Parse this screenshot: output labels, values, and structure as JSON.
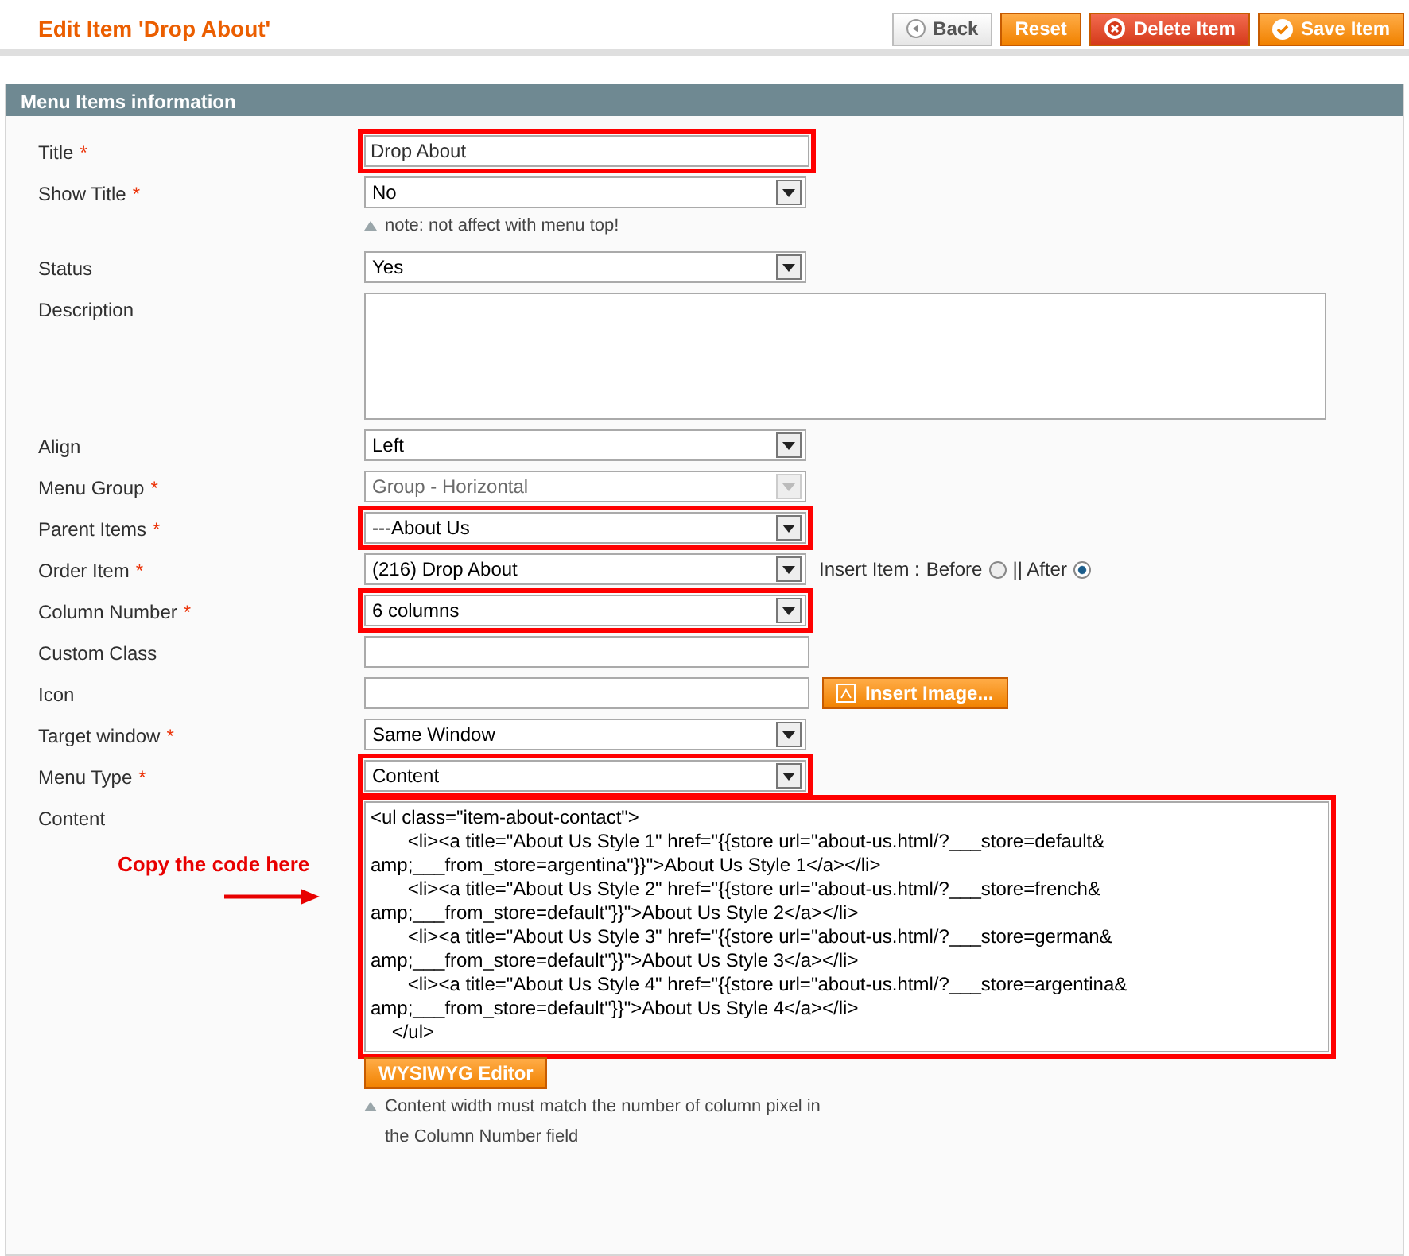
{
  "page_title": "Edit Item 'Drop About'",
  "actions": [
    {
      "label": "Back",
      "kind": "back"
    },
    {
      "label": "Reset",
      "kind": "reset"
    },
    {
      "label": "Delete Item",
      "kind": "delete"
    },
    {
      "label": "Save Item",
      "kind": "save"
    }
  ],
  "section": {
    "title": "Menu Items information"
  },
  "fields": [
    {
      "label": "Title",
      "required_mark": "*",
      "kind": "text",
      "value": "Drop About",
      "highlighted": true
    },
    {
      "label": "Show Title",
      "required_mark": "*",
      "kind": "select",
      "value": "No",
      "highlighted": false,
      "note": "note: not affect with menu top!"
    },
    {
      "label": "Status",
      "kind": "select",
      "value": "Yes",
      "highlighted": false
    },
    {
      "label": "Description",
      "kind": "textarea",
      "highlighted": false
    },
    {
      "label": "Align",
      "kind": "select",
      "value": "Left",
      "highlighted": false
    },
    {
      "label": "Menu Group",
      "required_mark": "*",
      "kind": "select",
      "value": "Group - Horizontal",
      "highlighted": false,
      "disabled": true
    },
    {
      "label": "Parent Items",
      "required_mark": "*",
      "kind": "select",
      "value": "---About Us",
      "highlighted": true
    },
    {
      "label": "Order Item",
      "required_mark": "*",
      "kind": "select",
      "value": "(216) Drop About",
      "highlighted": false,
      "insert": {
        "label": "Insert Item :",
        "options": [
          {
            "label": "Before",
            "selected": false
          },
          {
            "label": "|| After",
            "selected": true
          }
        ]
      }
    },
    {
      "label": "Column Number",
      "required_mark": "*",
      "kind": "select",
      "value": "6 columns",
      "highlighted": true
    },
    {
      "label": "Custom Class",
      "kind": "text",
      "highlighted": false
    },
    {
      "label": "Icon",
      "kind": "text",
      "highlighted": false,
      "button": "Insert Image..."
    },
    {
      "label": "Target window",
      "required_mark": "*",
      "kind": "select",
      "value": "Same Window",
      "highlighted": false
    },
    {
      "label": "Menu Type",
      "required_mark": "*",
      "kind": "select",
      "value": "Content",
      "highlighted": true
    },
    {
      "label": "Content",
      "kind": "code",
      "highlighted": true,
      "annotation": "Copy the code here",
      "button": "WYSIWYG Editor",
      "note": "Content width must match the number of column pixel in the Column Number field",
      "lines": [
        "<ul class=\"item-about-contact\">",
        "\t\t<li><a title=\"About Us Style 1\" href=\"{{store url=\"about-us.html/?___store=default&",
        "amp;___from_store=argentina\"}}\">About Us Style 1</a></li>",
        "\t\t<li><a title=\"About Us Style 2\" href=\"{{store url=\"about-us.html/?___store=french&",
        "amp;___from_store=default\"}}\">About Us Style 2</a></li>",
        "\t\t<li><a title=\"About Us Style 3\" href=\"{{store url=\"about-us.html/?___store=german&",
        "amp;___from_store=default\"}}\">About Us Style 3</a></li>",
        "\t\t<li><a title=\"About Us Style 4\" href=\"{{store url=\"about-us.html/?___store=argentina&",
        "amp;___from_store=default\"}}\">About Us Style 4</a></li>",
        "    </ul>"
      ]
    }
  ]
}
